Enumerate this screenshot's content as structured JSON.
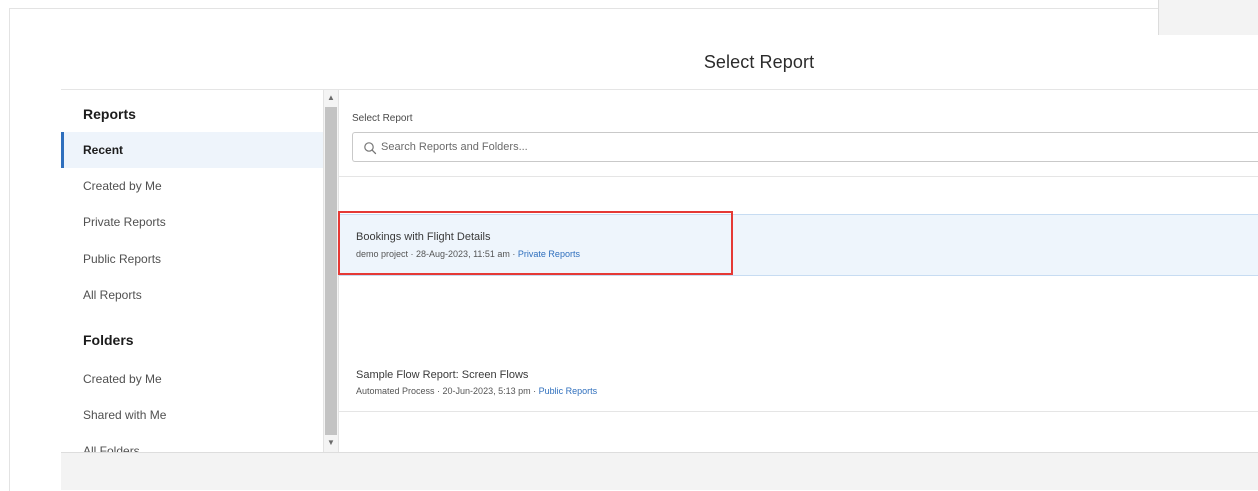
{
  "modal": {
    "title": "Select Report"
  },
  "sidebar": {
    "reports_heading": "Reports",
    "report_items": [
      {
        "label": "Recent",
        "active": true
      },
      {
        "label": "Created by Me",
        "active": false
      },
      {
        "label": "Private Reports",
        "active": false
      },
      {
        "label": "Public Reports",
        "active": false
      },
      {
        "label": "All Reports",
        "active": false
      }
    ],
    "folders_heading": "Folders",
    "folder_items": [
      {
        "label": "Created by Me"
      },
      {
        "label": "Shared with Me"
      },
      {
        "label": "All Folders"
      }
    ]
  },
  "main": {
    "field_label": "Select Report",
    "search": {
      "placeholder": "Search Reports and Folders...",
      "icon": "search-icon"
    },
    "reports": [
      {
        "name": "Bookings with Flight Details",
        "meta_prefix": "demo project · 28-Aug-2023, 11:51 am · ",
        "folder": "Private Reports",
        "selected": true
      },
      {
        "name": "Sample Flow Report: Screen Flows",
        "meta_prefix": "Automated Process · 20-Jun-2023, 5:13 pm · ",
        "folder": "Public Reports",
        "selected": false
      }
    ]
  },
  "colors": {
    "accent": "#2f6fbd",
    "selected_row": "#eef5fc",
    "highlight": "#e53935"
  }
}
